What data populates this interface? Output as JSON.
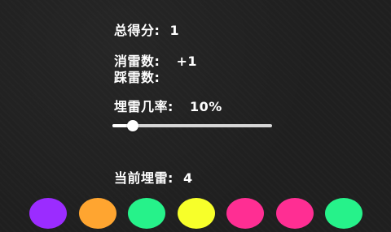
{
  "stats": {
    "total_score_label": "总得分:",
    "total_score_value": "1",
    "cleared_label": "消雷数:",
    "cleared_value": "+1",
    "stepped_label": "踩雷数:",
    "stepped_value": ""
  },
  "mine_rate": {
    "label": "埋雷几率:",
    "value_text": "10%",
    "value": 0.1
  },
  "current": {
    "label": "当前埋雷:",
    "value": "4"
  },
  "colors": [
    {
      "name": "purple",
      "hex": "#9b2cff"
    },
    {
      "name": "orange",
      "hex": "#ffa530"
    },
    {
      "name": "green",
      "hex": "#26f28a"
    },
    {
      "name": "yellow",
      "hex": "#f7ff2a"
    },
    {
      "name": "pink",
      "hex": "#ff2e93"
    },
    {
      "name": "pink",
      "hex": "#ff2e93"
    },
    {
      "name": "green",
      "hex": "#26f28a"
    }
  ]
}
